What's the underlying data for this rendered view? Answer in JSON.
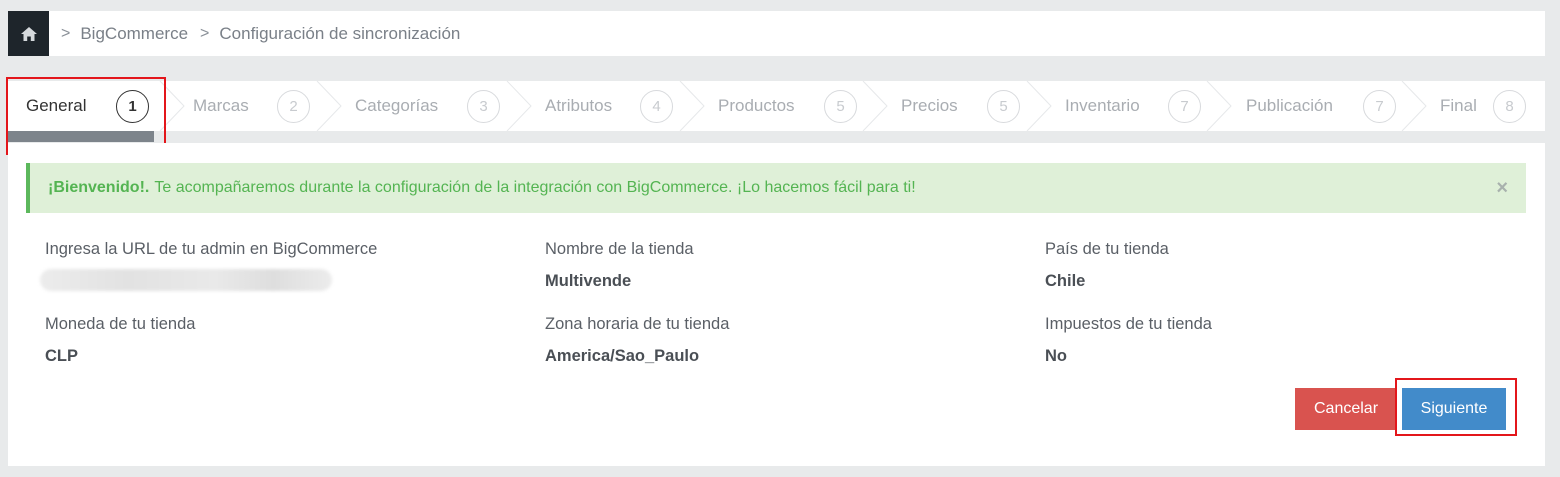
{
  "breadcrumb": {
    "home_icon": "home-icon",
    "items": [
      "BigCommerce",
      "Configuración de sincronización"
    ]
  },
  "steps": [
    {
      "label": "General",
      "num": "1",
      "active": true
    },
    {
      "label": "Marcas",
      "num": "2"
    },
    {
      "label": "Categorías",
      "num": "3"
    },
    {
      "label": "Atributos",
      "num": "4"
    },
    {
      "label": "Productos",
      "num": "5"
    },
    {
      "label": "Precios",
      "num": "5"
    },
    {
      "label": "Inventario",
      "num": "7"
    },
    {
      "label": "Publicación",
      "num": "7"
    },
    {
      "label": "Final",
      "num": "8"
    }
  ],
  "alert": {
    "strong": "¡Bienvenido!.",
    "text": "Te acompañaremos durante la configuración de la integración con BigCommerce. ¡Lo hacemos fácil para ti!",
    "close": "×"
  },
  "fields": {
    "admin_url": {
      "label": "Ingresa la URL de tu admin en BigCommerce"
    },
    "store_name": {
      "label": "Nombre de la tienda",
      "value": "Multivende"
    },
    "country": {
      "label": "País de tu tienda",
      "value": "Chile"
    },
    "currency": {
      "label": "Moneda de tu tienda",
      "value": "CLP"
    },
    "timezone": {
      "label": "Zona horaria de tu tienda",
      "value": "America/Sao_Paulo"
    },
    "taxes": {
      "label": "Impuestos de tu tienda",
      "value": "No"
    }
  },
  "buttons": {
    "cancel": "Cancelar",
    "next": "Siguiente"
  },
  "colors": {
    "alert_bg": "#dff0d8",
    "alert_text": "#54b452",
    "cancel": "#d9534f",
    "primary": "#428bca",
    "highlight": "#e3161b"
  }
}
